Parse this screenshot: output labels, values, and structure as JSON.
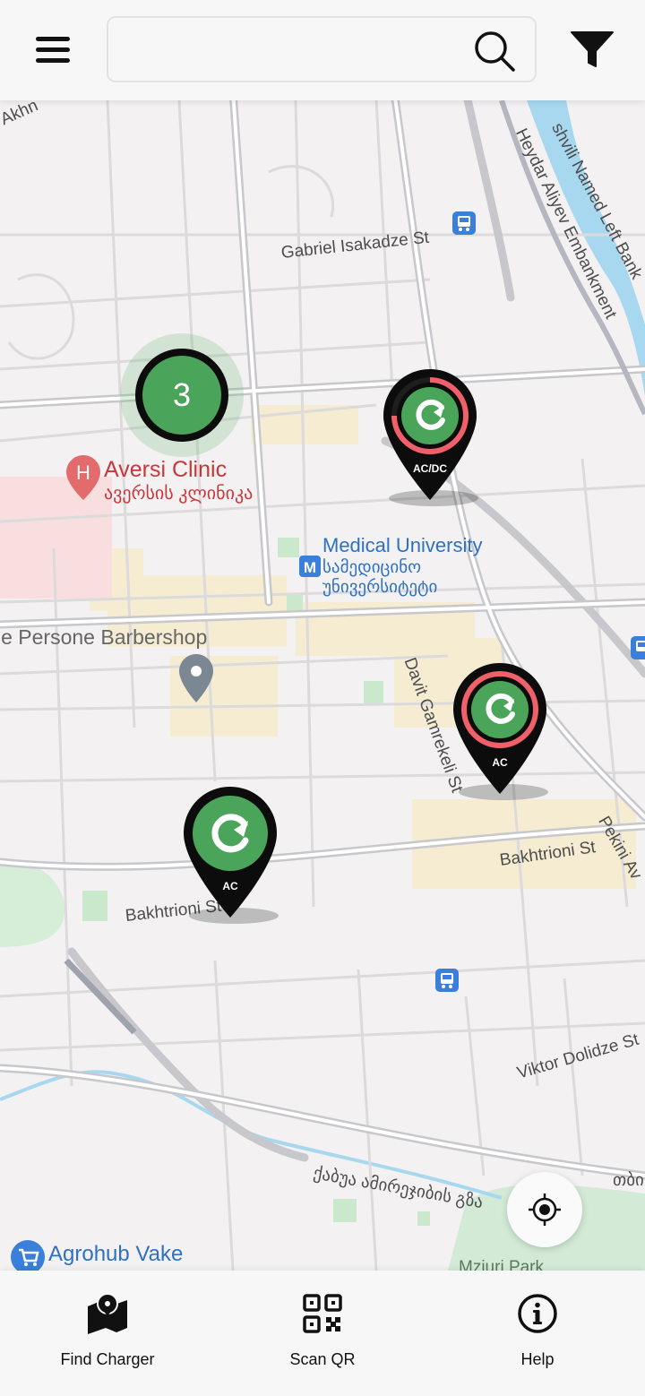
{
  "header": {
    "search_placeholder": "",
    "icons": {
      "menu": "menu-icon",
      "search": "search-icon",
      "filter": "filter-icon"
    }
  },
  "map": {
    "streets": [
      "Gabriel Isakadze St",
      "Bakhtrioni St",
      "Bakhtrioni St",
      "Davit Gamrekeli St",
      "Viktor Dolidze St",
      "Pekini Av",
      "Heydar Aliyev Embankment",
      "shvili Named Left Bank",
      "ქაბუა ამირეჯიბის გზა",
      "Mziuri Park",
      "Akhn",
      "თბი"
    ],
    "pois": {
      "clinic_name": "Aversi Clinic",
      "clinic_name_ka": "ავერსის კლინიკა",
      "university_name": "Medical University",
      "university_name_ka_1": "სამედიცინო",
      "university_name_ka_2": "უნივერსიტეტი",
      "barbershop_name": "le Persone Barbershop",
      "store_name": "Agrohub Vake"
    },
    "cluster": {
      "count": "3"
    },
    "chargers": [
      {
        "type": "AC/DC",
        "ring_color": "#f0606a",
        "status": "partial"
      },
      {
        "type": "AC",
        "ring_color": "#f0606a",
        "status": "busy"
      },
      {
        "type": "AC",
        "ring_color": "",
        "status": "available"
      }
    ],
    "colors": {
      "marker_green": "#4aa55a",
      "marker_black": "#0c0c0c",
      "ring_red": "#f0606a"
    }
  },
  "bottom_nav": [
    {
      "label": "Find Charger",
      "icon": "map-icon"
    },
    {
      "label": "Scan QR",
      "icon": "qr-code-icon"
    },
    {
      "label": "Help",
      "icon": "info-icon"
    }
  ]
}
